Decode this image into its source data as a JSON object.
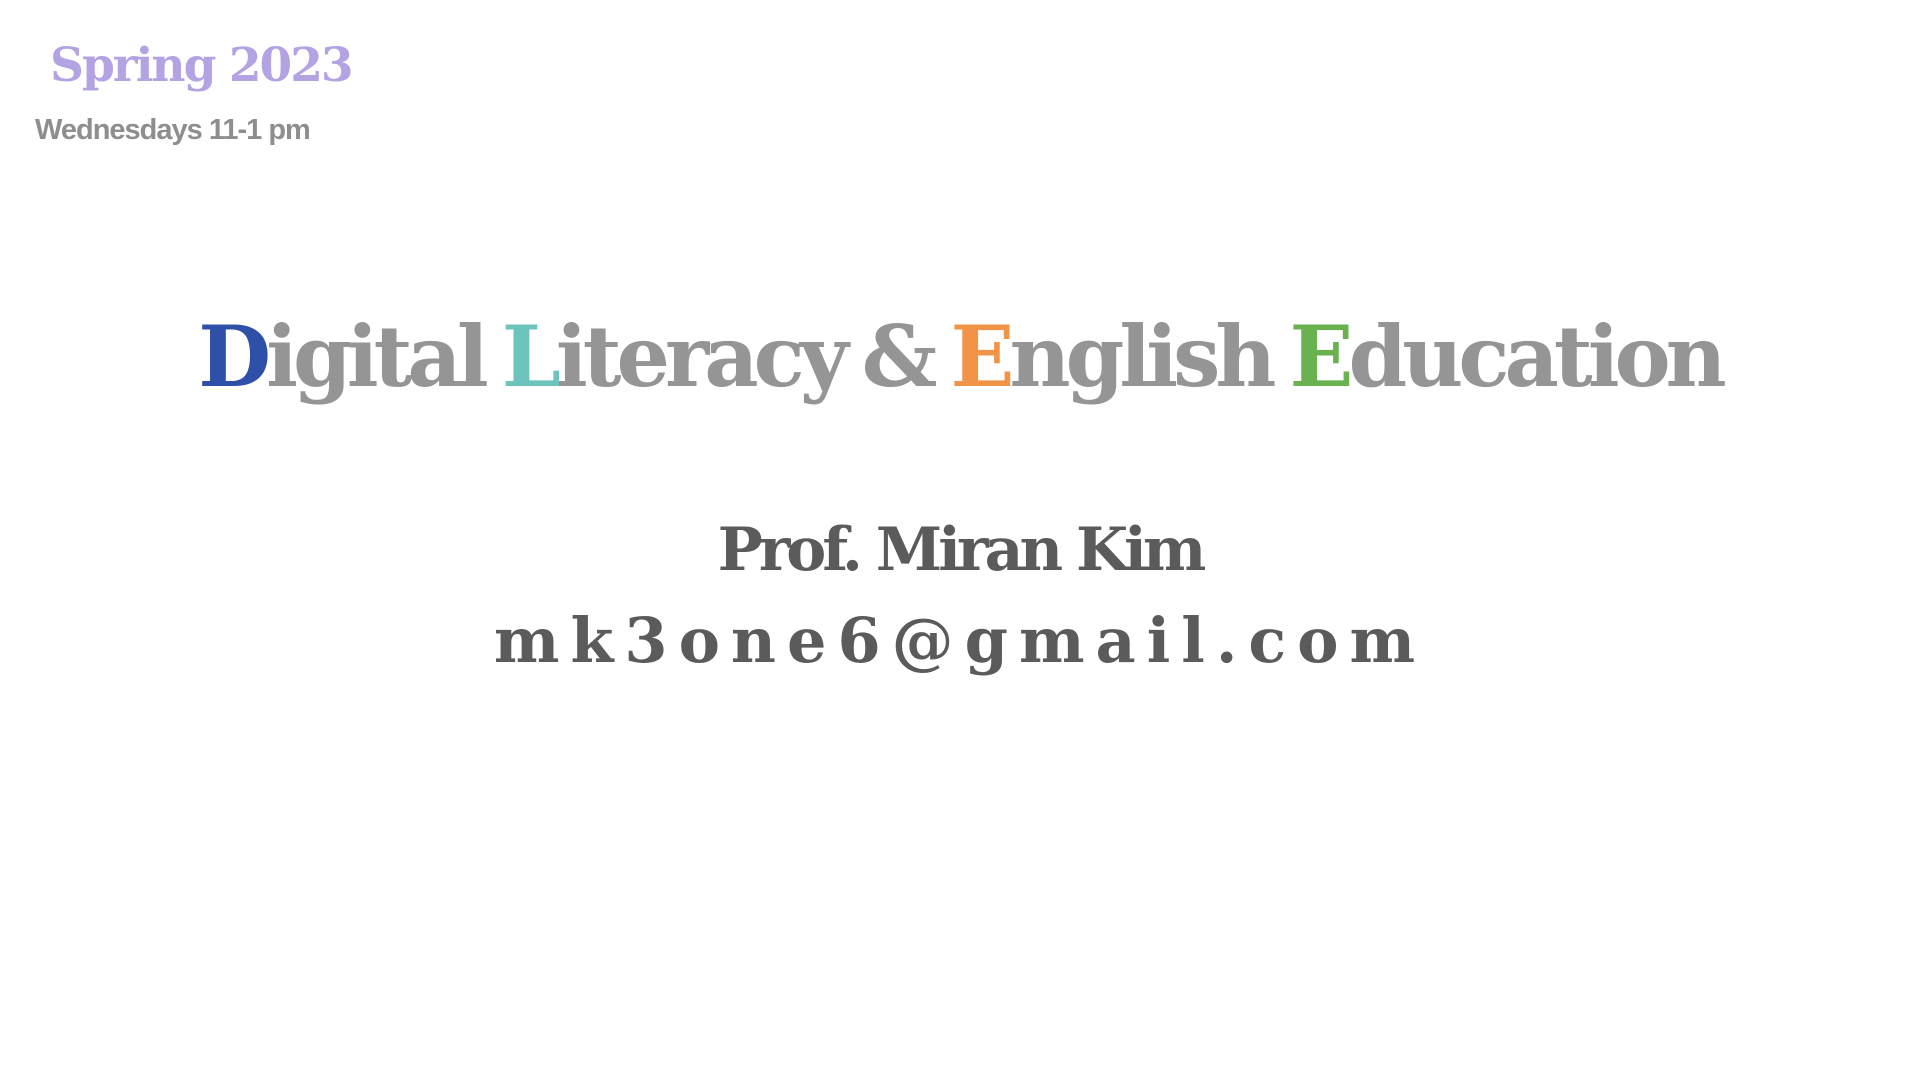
{
  "header": {
    "term": "Spring 2023",
    "schedule": "Wednesdays 11-1 pm"
  },
  "title": {
    "words": [
      {
        "initial": "D",
        "rest": "igital",
        "initial_color": "#2f50a8"
      },
      {
        "initial": "L",
        "rest": "iteracy",
        "initial_color": "#6cc4bd"
      },
      {
        "initial": "",
        "rest": "&",
        "initial_color": "#959595"
      },
      {
        "initial": "E",
        "rest": "nglish",
        "initial_color": "#f29447"
      },
      {
        "initial": "E",
        "rest": "ducation",
        "initial_color": "#6ab250"
      }
    ],
    "text_color": "#959595"
  },
  "instructor": {
    "name": "Prof. Miran Kim",
    "email": "mk3one6@gmail.com"
  },
  "colors": {
    "term": "#b3a3e3",
    "schedule": "#8e8e8e",
    "instructor_text": "#5b5b5b",
    "background": "#ffffff"
  }
}
